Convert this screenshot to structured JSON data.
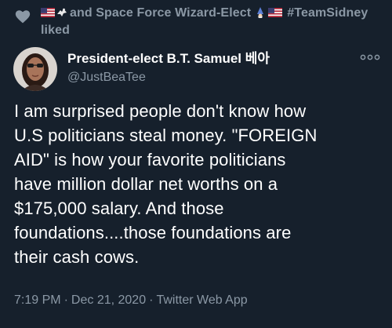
{
  "social_context": {
    "icon": "heart-icon",
    "emoji_prefix": [
      "us-flag-emoji",
      "eagle-emoji"
    ],
    "text_part1": "and Space Force Wizard-Elect",
    "emoji_mid": [
      "wizard-emoji",
      "us-flag-emoji"
    ],
    "text_part2": "#TeamSidney",
    "text_part3": "liked"
  },
  "tweet": {
    "author": {
      "display_name": "President-elect B.T. Samuel 베아",
      "handle": "@JustBeaTee",
      "avatar": "avatar-photo"
    },
    "more_icon": "more-options-icon",
    "text": "I am surprised people don't know how\nU.S politicians steal money. \"FOREIGN\nAID\" is how your  favorite politicians\nhave million dollar net worths on a\n$175,000 salary. And those\nfoundations....those foundations  are\ntheir cash cows.",
    "time": "7:19 PM",
    "date": "Dec 21, 2020",
    "separator": "·",
    "source": "Twitter Web App"
  },
  "colors": {
    "background": "#16202c",
    "primary_text": "#ffffff",
    "secondary_text": "#8b98a5"
  }
}
